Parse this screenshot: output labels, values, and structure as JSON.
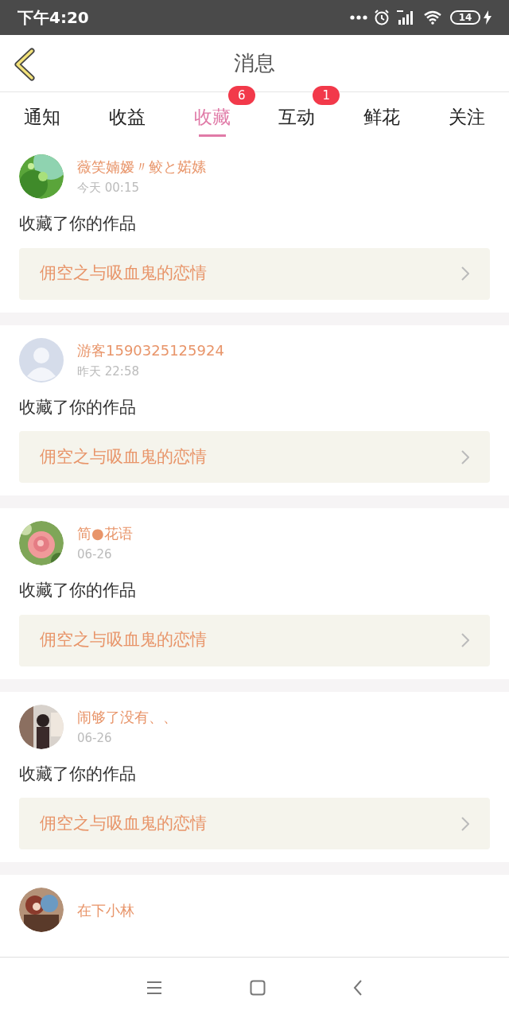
{
  "status_bar": {
    "time": "下午4:20",
    "battery": "14"
  },
  "header": {
    "title": "消息"
  },
  "tabs": [
    {
      "label": "通知",
      "selected": false
    },
    {
      "label": "收益",
      "selected": false
    },
    {
      "label": "收藏",
      "selected": true,
      "badge": "6"
    },
    {
      "label": "互动",
      "selected": false,
      "badge": "1"
    },
    {
      "label": "鲜花",
      "selected": false
    },
    {
      "label": "关注",
      "selected": false
    }
  ],
  "messages": [
    {
      "name": "薇笑婻嫒〃鲛と婼嫊",
      "time": "今天 00:15",
      "action": "收藏了你的作品",
      "work": "佣空之与吸血鬼的恋情"
    },
    {
      "kind": "placeholder",
      "name": "游客1590325125924",
      "time": "昨天 22:58",
      "action": "收藏了你的作品",
      "work": "佣空之与吸血鬼的恋情"
    },
    {
      "name": "简●花语",
      "time": "06-26",
      "action": "收藏了你的作品",
      "work": "佣空之与吸血鬼的恋情"
    },
    {
      "name": "闹够了没有、、",
      "time": "06-26",
      "action": "收藏了你的作品",
      "work": "佣空之与吸血鬼的恋情"
    },
    {
      "name": "在下小林"
    }
  ]
}
